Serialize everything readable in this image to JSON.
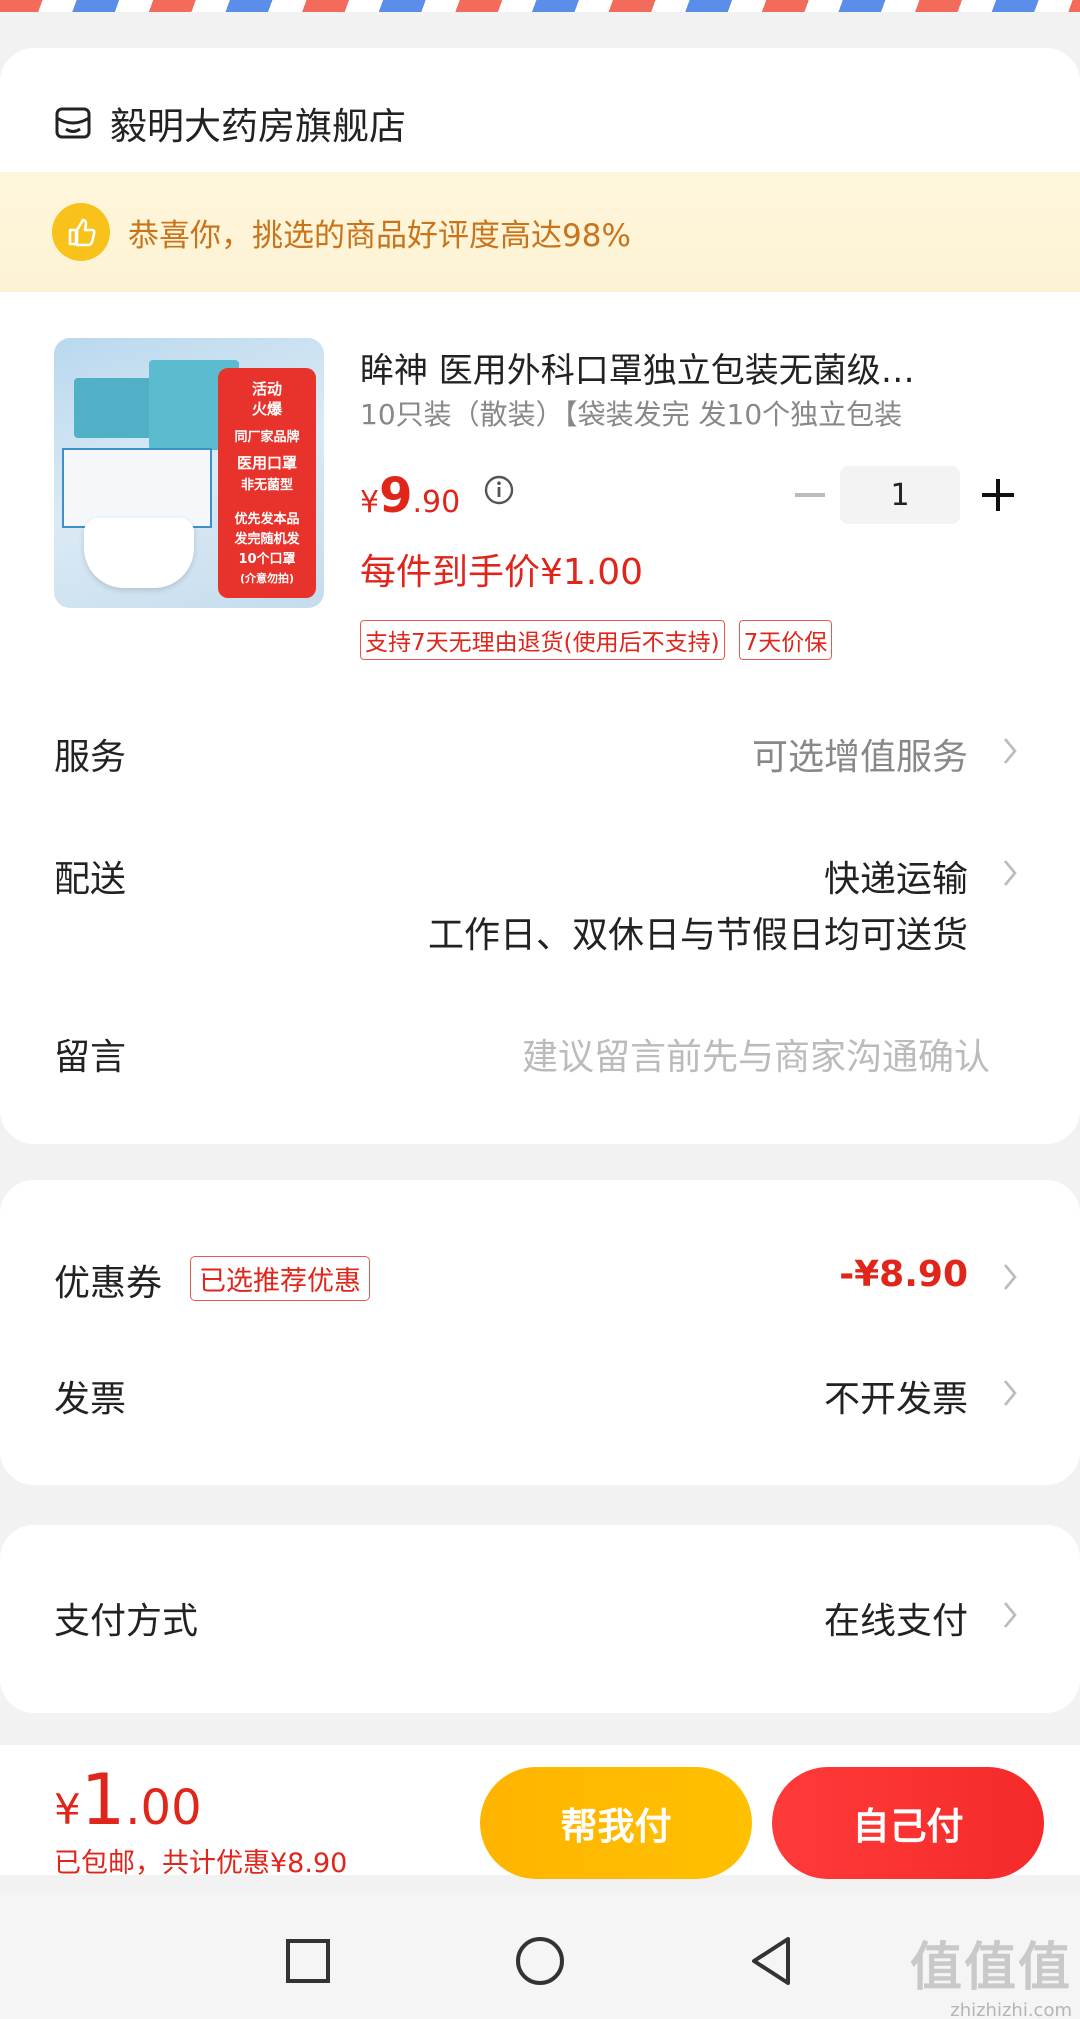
{
  "shop": {
    "name": "毅明大药房旗舰店",
    "icon": "shop-icon"
  },
  "banner": {
    "text": "恭喜你，挑选的商品好评度高达98%",
    "icon": "thumbs-up-icon"
  },
  "product": {
    "title": "眸神 医用外科口罩独立包装无菌级…",
    "spec": "10只装（散装）【袋装发完 发10个独立包装",
    "price": {
      "currency": "¥",
      "integer": "9",
      "decimal": ".90"
    },
    "quantity": "1",
    "final_price": "每件到手价¥1.00",
    "tags": [
      "支持7天无理由退货(使用后不支持)",
      "7天价保"
    ],
    "image_text": {
      "line1": "活动",
      "line2": "火爆",
      "line3": "同厂家品牌",
      "line4": "医用口罩",
      "line5": "非无菌型",
      "line6": "优先发本品",
      "line7": "发完随机发",
      "line8": "10个口罩",
      "line9": "(介意勿拍)"
    }
  },
  "rows": {
    "service": {
      "label": "服务",
      "value": "可选增值服务"
    },
    "delivery": {
      "label": "配送",
      "value": "快递运输",
      "sub": "工作日、双休日与节假日均可送货"
    },
    "message": {
      "label": "留言",
      "placeholder": "建议留言前先与商家沟通确认"
    },
    "coupon": {
      "label": "优惠券",
      "badge": "已选推荐优惠",
      "value": "-¥8.90"
    },
    "invoice": {
      "label": "发票",
      "value": "不开发票"
    },
    "payment": {
      "label": "支付方式",
      "value": "在线支付"
    }
  },
  "footer": {
    "total": {
      "currency": "¥",
      "integer": "1",
      "decimal": ".00"
    },
    "sub": "已包邮，共计优惠¥8.90",
    "help_pay": "帮我付",
    "self_pay": "自己付"
  },
  "watermark": {
    "big": "值值值",
    "small": "zhizhizhi.com"
  },
  "colors": {
    "accent": "#e0251b",
    "yellow": "#ffb400",
    "banner_text": "#c9741a"
  }
}
